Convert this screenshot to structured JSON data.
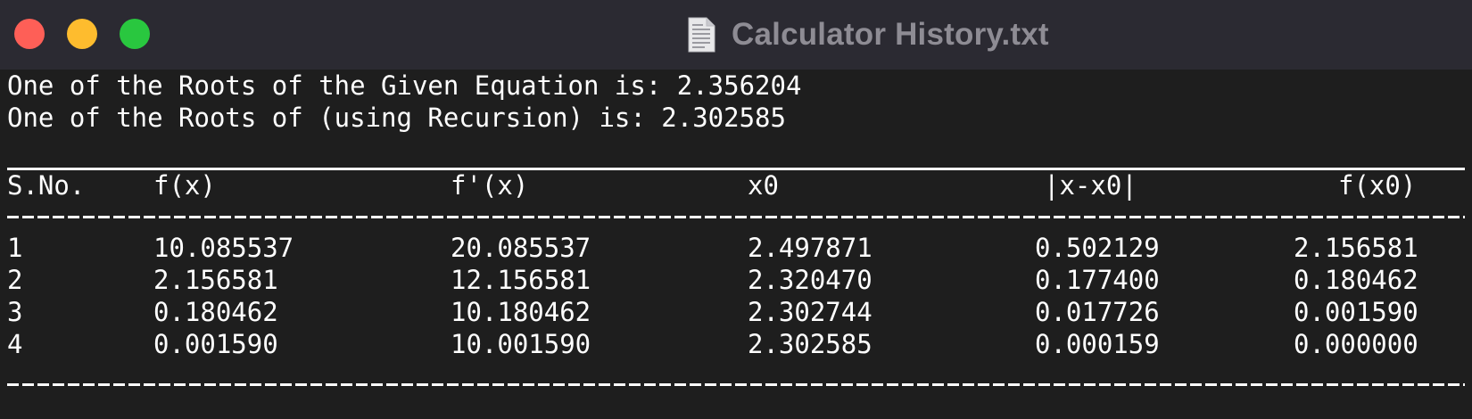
{
  "window": {
    "title": "Calculator History.txt",
    "title_icon": "text-document-icon",
    "traffic_lights": {
      "close_color": "#fe5f57",
      "minimize_color": "#febc2e",
      "maximize_color": "#29c73f"
    }
  },
  "output": {
    "line1": "One of the Roots of the Given Equation is: 2.356204",
    "line2": "One of the Roots of (using Recursion) is: 2.302585"
  },
  "table": {
    "headers": [
      "S.No.",
      "f(x)",
      "f'(x)",
      "x0",
      "|x-x0|",
      "f(x0)"
    ],
    "rows": [
      [
        "1",
        "10.085537",
        "20.085537",
        "2.497871",
        "0.502129",
        "2.156581"
      ],
      [
        "2",
        "2.156581",
        "12.156581",
        "2.320470",
        "0.177400",
        "0.180462"
      ],
      [
        "3",
        "0.180462",
        "10.180462",
        "2.302744",
        "0.017726",
        "0.001590"
      ],
      [
        "4",
        "0.001590",
        "10.001590",
        "2.302585",
        "0.000159",
        "0.000000"
      ]
    ]
  },
  "colors": {
    "background": "#1e1e1e",
    "titlebar": "#2b2a32",
    "text": "#ffffff",
    "title_text": "#8e8c94"
  }
}
